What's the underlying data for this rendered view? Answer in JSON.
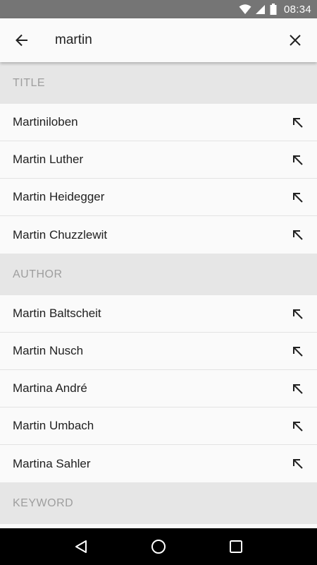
{
  "status_bar": {
    "time": "08:34"
  },
  "search": {
    "query": "martin"
  },
  "sections": {
    "title": {
      "header": "TITLE",
      "items": [
        "Martiniloben",
        "Martin Luther",
        "Martin Heidegger",
        "Martin Chuzzlewit"
      ]
    },
    "author": {
      "header": "AUTHOR",
      "items": [
        "Martin Baltscheit",
        "Martin Nusch",
        "Martina André",
        "Martin Umbach",
        "Martina Sahler"
      ]
    },
    "keyword": {
      "header": "KEYWORD"
    }
  },
  "colors": {
    "status_bar": "#757575",
    "section_header_bg": "#e6e6e6",
    "section_header_text": "#9e9e9e",
    "text_primary": "#212121",
    "nav_bar": "#000000"
  },
  "icons": {
    "back": "arrow-back-icon",
    "clear": "close-icon",
    "fill_query": "arrow-up-left-icon",
    "nav_back": "triangle-back-icon",
    "nav_home": "circle-home-icon",
    "nav_recents": "square-recents-icon"
  }
}
